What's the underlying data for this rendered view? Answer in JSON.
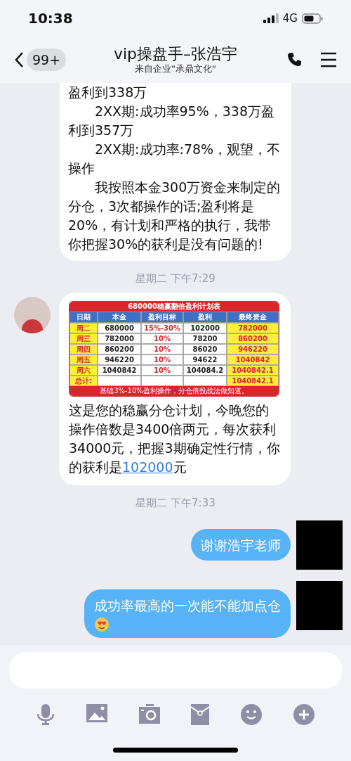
{
  "status_bar": {
    "time": "10:38",
    "network": "4G"
  },
  "header": {
    "back_badge": "99+",
    "title": "vip操盘手–张浩宇",
    "subtitle": "来自企业\"承鼎文化\""
  },
  "messages": [
    {
      "kind": "incoming_text",
      "paragraphs": [
        {
          "text": "盈利到338万",
          "indent": false
        },
        {
          "text": "2XX期:成功率95%，338万盈利到357万",
          "indent": true
        },
        {
          "text": "2XX期:成功率:78%，观望，不操作",
          "indent": true
        },
        {
          "text": "我按照本金300万资金来制定的分仓，3次都操作的话;盈利将是20%，有计划和严格的执行，我带你把握30%的获利是没有问题的!",
          "indent": true
        }
      ]
    },
    {
      "kind": "timestamp",
      "text": "星期二 下午7:29"
    },
    {
      "kind": "incoming_image_text",
      "table": {
        "title": "680000稳赢翻倍盈利计划表",
        "columns": [
          "日期",
          "本金",
          "盈利目标",
          "盈利",
          "最终资金"
        ],
        "rows": [
          [
            "周二",
            "680000",
            "15%-30%",
            "102000",
            "782000"
          ],
          [
            "周三",
            "782000",
            "10%",
            "78200",
            "860200"
          ],
          [
            "周四",
            "860200",
            "10%",
            "86020",
            "946220"
          ],
          [
            "周五",
            "946220",
            "10%",
            "94622",
            "1040842"
          ],
          [
            "周六",
            "1040842",
            "10%",
            "104084.2",
            "1040842.1"
          ],
          [
            "总计:",
            "",
            "",
            "",
            "1040842.1"
          ]
        ],
        "footer": "基础3%-10%盈利操作，分仓倍投战法做知道。"
      },
      "text": "这是您的稳赢分仓计划，今晚您的操作倍数是3400倍两元，每次获利34000元，把握3期确定性行情，你的获利是",
      "link": "102000",
      "text_after": "元"
    },
    {
      "kind": "timestamp",
      "text": "星期二 下午7:33"
    },
    {
      "kind": "outgoing_text",
      "text": "谢谢浩宇老师",
      "emoji": false
    },
    {
      "kind": "outgoing_text",
      "text": "成功率最高的一次能不能加点仓",
      "emoji": true
    }
  ]
}
